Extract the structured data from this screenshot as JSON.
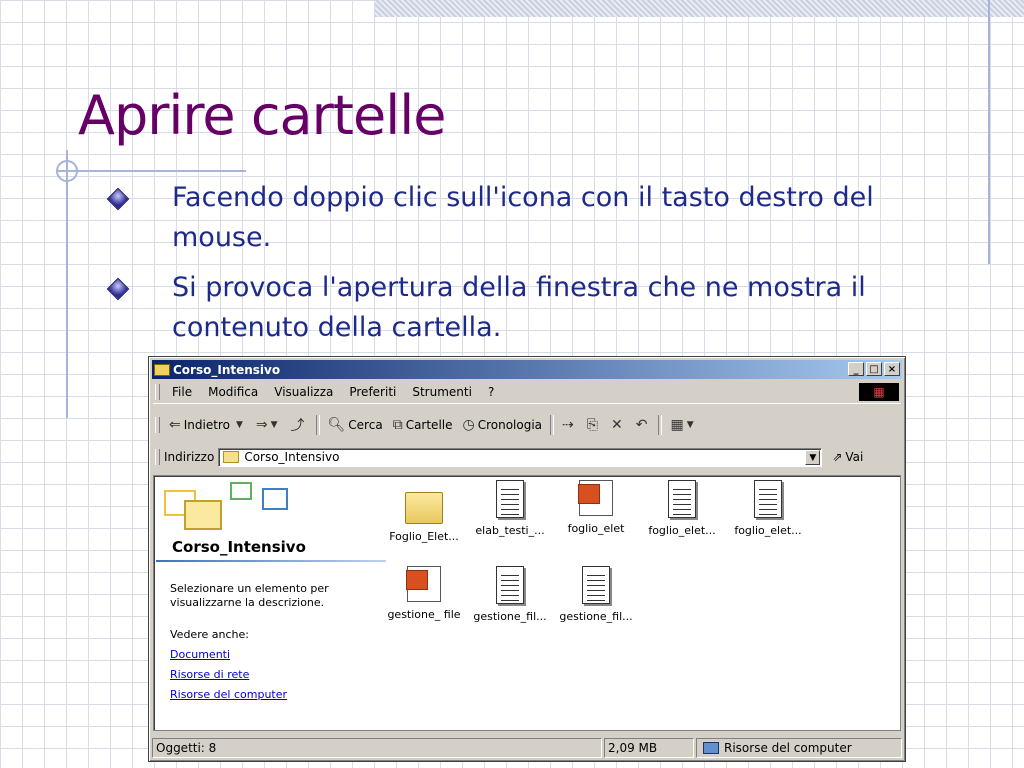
{
  "slide": {
    "title": "Aprire cartelle",
    "bullets": [
      "Facendo doppio clic sull'icona con il tasto destro del mouse.",
      "Si provoca l'apertura della finestra che ne mostra il contenuto della cartella."
    ]
  },
  "window": {
    "title": "Corso_Intensivo",
    "controls": [
      "_",
      "□",
      "×"
    ],
    "menu": [
      "File",
      "Modifica",
      "Visualizza",
      "Preferiti",
      "Strumenti",
      "?"
    ],
    "toolbar": {
      "back": "Indietro",
      "search": "Cerca",
      "folders": "Cartelle",
      "history": "Cronologia"
    },
    "address": {
      "label": "Indirizzo",
      "value": "Corso_Intensivo",
      "go": "Vai"
    },
    "left_pane": {
      "folder_name": "Corso_Intensivo",
      "description": "Selezionare un elemento per visualizzarne la descrizione.",
      "see_also": "Vedere anche:",
      "links": [
        "Documenti",
        "Risorse di rete",
        "Risorse del computer"
      ]
    },
    "files": [
      {
        "name": "Foglio_Elet...",
        "type": "folder"
      },
      {
        "name": "elab_testi_...",
        "type": "doc"
      },
      {
        "name": "foglio_elet",
        "type": "ppt"
      },
      {
        "name": "foglio_elet...",
        "type": "doc"
      },
      {
        "name": "foglio_elet...",
        "type": "doc"
      },
      {
        "name": "gestione_ file",
        "type": "ppt"
      },
      {
        "name": "gestione_fil...",
        "type": "doc"
      },
      {
        "name": "gestione_fil...",
        "type": "doc"
      }
    ],
    "status": {
      "objects": "Oggetti: 8",
      "size": "2,09 MB",
      "location": "Risorse del computer"
    }
  }
}
